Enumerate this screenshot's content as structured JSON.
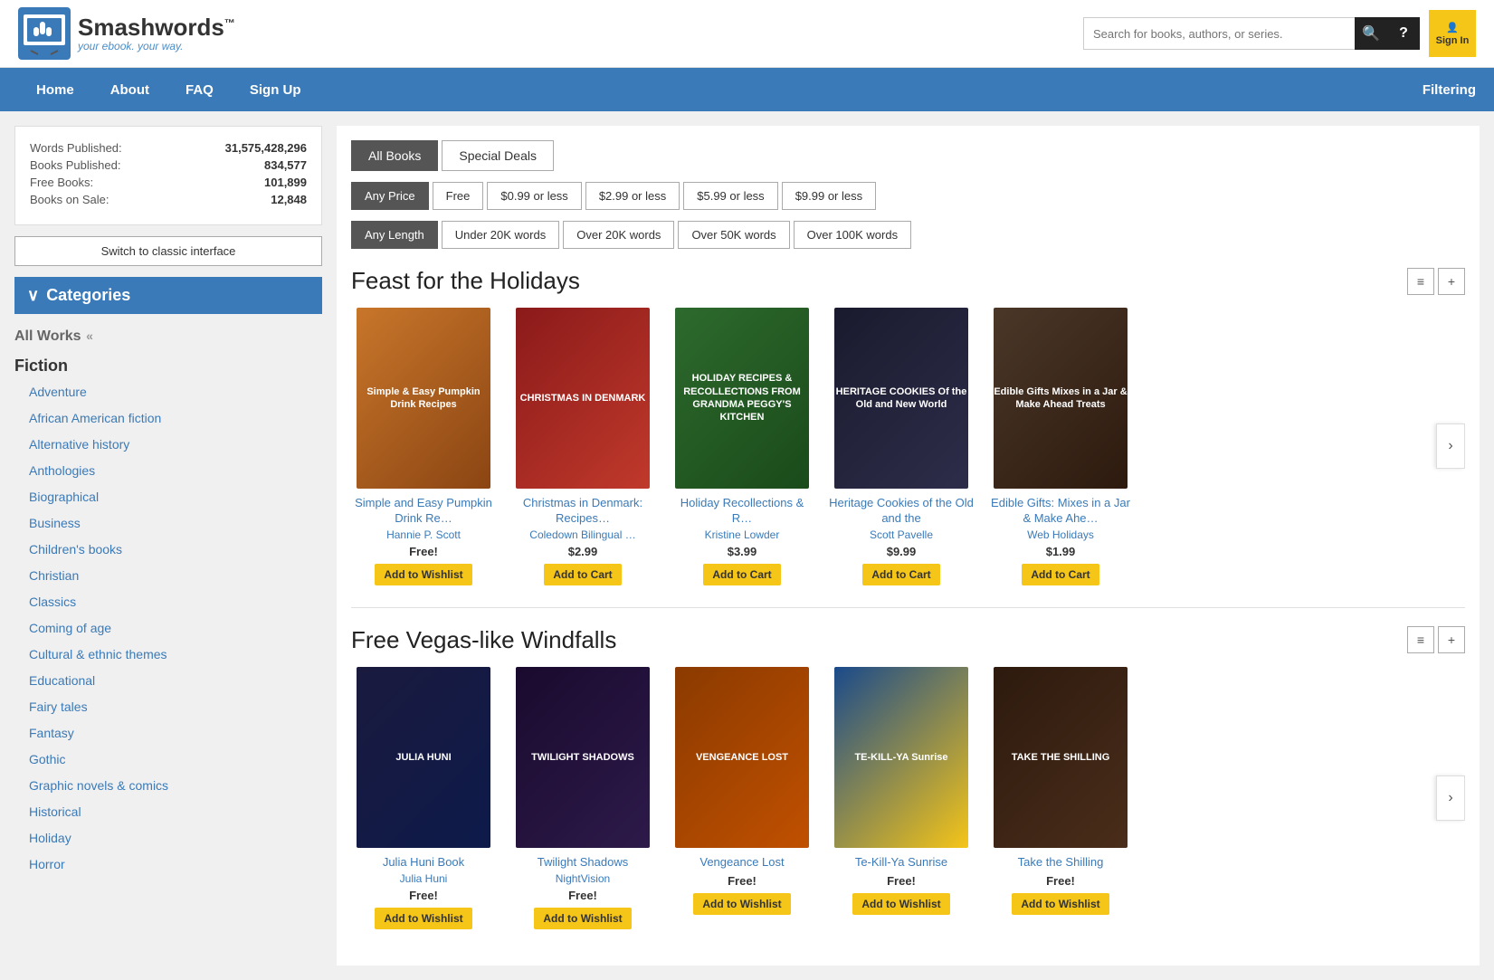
{
  "header": {
    "logo_name": "Smashwords",
    "logo_tm": "™",
    "logo_tagline": "your ebook. your way.",
    "search_placeholder": "Search for books, authors, or series.",
    "sign_in_label": "Sign In"
  },
  "navbar": {
    "items": [
      "Home",
      "About",
      "FAQ",
      "Sign Up"
    ],
    "right_label": "Filtering"
  },
  "stats": {
    "words_published_label": "Words Published:",
    "words_published_value": "31,575,428,296",
    "books_published_label": "Books Published:",
    "books_published_value": "834,577",
    "free_books_label": "Free Books:",
    "free_books_value": "101,899",
    "books_on_sale_label": "Books on Sale:",
    "books_on_sale_value": "12,848"
  },
  "classic_interface_btn": "Switch to classic interface",
  "categories": {
    "header": "Categories",
    "all_works": "All Works",
    "all_works_suffix": "«",
    "fiction_label": "Fiction",
    "items": [
      "Adventure",
      "African American fiction",
      "Alternative history",
      "Anthologies",
      "Biographical",
      "Business",
      "Children's books",
      "Christian",
      "Classics",
      "Coming of age",
      "Cultural & ethnic themes",
      "Educational",
      "Fairy tales",
      "Fantasy",
      "Gothic",
      "Graphic novels & comics",
      "Historical",
      "Holiday",
      "Horror"
    ]
  },
  "filters": {
    "book_type_tabs": [
      "All Books",
      "Special Deals"
    ],
    "book_type_active": 0,
    "price_buttons": [
      "Any Price",
      "Free",
      "$0.99 or less",
      "$2.99 or less",
      "$5.99 or less",
      "$9.99 or less"
    ],
    "price_active": 0,
    "length_buttons": [
      "Any Length",
      "Under 20K words",
      "Over 20K words",
      "Over 50K words",
      "Over 100K words"
    ],
    "length_active": 0
  },
  "section1": {
    "title": "Feast for the Holidays",
    "books": [
      {
        "title": "Simple and Easy Pumpkin Drink Re…",
        "author": "Hannie P. Scott",
        "price": "Free!",
        "button_label": "Add to Wishlist",
        "cover_text": "Simple & Easy Pumpkin Drink Recipes",
        "cover_class": "cover-1"
      },
      {
        "title": "Christmas in Denmark: Recipes…",
        "author": "Coledown Bilingual …",
        "price": "$2.99",
        "button_label": "Add to Cart",
        "cover_text": "CHRISTMAS IN DENMARK",
        "cover_class": "cover-2"
      },
      {
        "title": "Holiday Recollections & R…",
        "author": "Kristine Lowder",
        "price": "$3.99",
        "button_label": "Add to Cart",
        "cover_text": "HOLIDAY RECIPES & RECOLLECTIONS FROM GRANDMA PEGGY'S KITCHEN",
        "cover_class": "cover-3"
      },
      {
        "title": "Heritage Cookies of the Old and the",
        "author": "Scott Pavelle",
        "price": "$9.99",
        "button_label": "Add to Cart",
        "cover_text": "HERITAGE COOKIES Of the Old and New World",
        "cover_class": "cover-4"
      },
      {
        "title": "Edible Gifts: Mixes in a Jar & Make Ahe…",
        "author": "Web Holidays",
        "price": "$1.99",
        "button_label": "Add to Cart",
        "cover_text": "Edible Gifts Mixes in a Jar & Make Ahead Treats",
        "cover_class": "cover-5"
      }
    ]
  },
  "section2": {
    "title": "Free Vegas-like Windfalls",
    "books": [
      {
        "title": "Julia Huni Book",
        "author": "Julia Huni",
        "price": "Free!",
        "button_label": "Add to Wishlist",
        "cover_text": "JULIA HUNI",
        "cover_class": "cover-v1"
      },
      {
        "title": "Twilight Shadows",
        "author": "NightVision",
        "price": "Free!",
        "button_label": "Add to Wishlist",
        "cover_text": "TWILIGHT SHADOWS",
        "cover_class": "cover-v2"
      },
      {
        "title": "Vengeance Lost",
        "author": "",
        "price": "Free!",
        "button_label": "Add to Wishlist",
        "cover_text": "VENGEANCE LOST",
        "cover_class": "cover-v3"
      },
      {
        "title": "Te-Kill-Ya Sunrise",
        "author": "",
        "price": "Free!",
        "button_label": "Add to Wishlist",
        "cover_text": "TE-KILL-YA Sunrise",
        "cover_class": "cover-v4"
      },
      {
        "title": "Take the Shilling",
        "author": "",
        "price": "Free!",
        "button_label": "Add to Wishlist",
        "cover_text": "TAKE THE SHILLING",
        "cover_class": "cover-v5"
      }
    ]
  },
  "icons": {
    "search": "🔍",
    "help": "?",
    "person": "👤",
    "chevron_down": "∨",
    "list": "≡",
    "plus": "+",
    "next": "›"
  }
}
